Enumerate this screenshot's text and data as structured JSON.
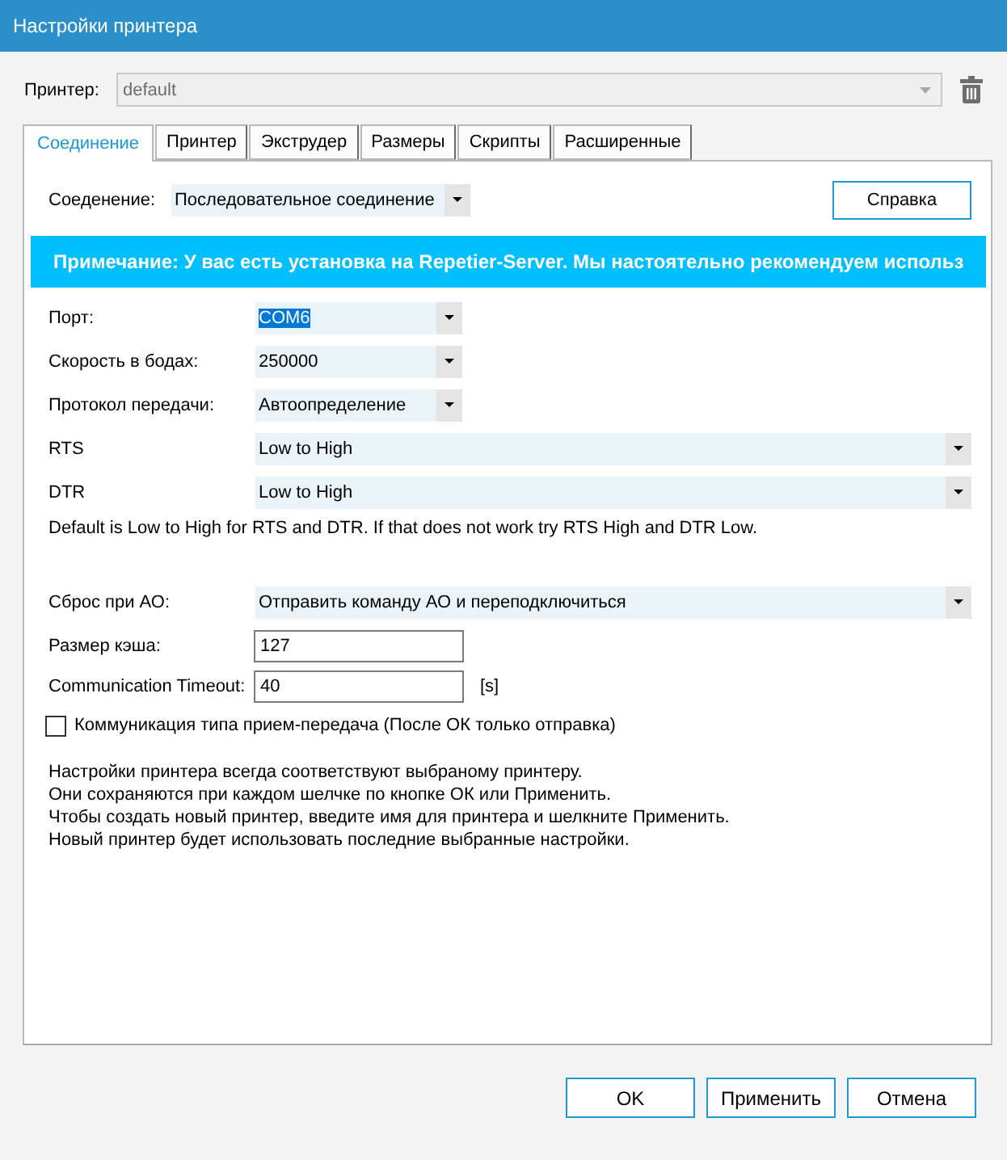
{
  "window": {
    "title": "Настройки принтера"
  },
  "printer": {
    "label": "Принтер:",
    "value": "default",
    "disabled": true
  },
  "tabs": [
    {
      "label": "Соединение",
      "selected": true
    },
    {
      "label": "Принтер",
      "selected": false
    },
    {
      "label": "Экструдер",
      "selected": false
    },
    {
      "label": "Размеры",
      "selected": false
    },
    {
      "label": "Скрипты",
      "selected": false
    },
    {
      "label": "Расширенные",
      "selected": false
    }
  ],
  "connection": {
    "label": "Соеденение:",
    "value": "Последовательное соединение",
    "help_button": "Справка"
  },
  "banner": {
    "text": "Примечание: У вас есть установка на Repetier-Server. Мы настоятельно рекомендуем использ"
  },
  "serial_settings": [
    {
      "label": "Порт:",
      "value": "COM6",
      "text_selected": true
    },
    {
      "label": "Скорость в бодах:",
      "value": "250000",
      "text_selected": false
    },
    {
      "label": "Протокол передачи:",
      "value": "Автоопределение",
      "text_selected": false
    }
  ],
  "signal_settings": [
    {
      "label": "RTS",
      "value": "Low to High"
    },
    {
      "label": "DTR",
      "value": "Low to High"
    }
  ],
  "signal_note": "Default is Low to High for RTS and DTR. If that does not work try RTS High and DTR Low.",
  "reset": {
    "label": "Сброс при АО:",
    "value": "Отправить команду АО и переподключиться"
  },
  "cache": {
    "label": "Размер кэша:",
    "value": "127"
  },
  "timeout": {
    "label": "Communication Timeout:",
    "value": "40",
    "unit": "[s]"
  },
  "ping_pong": {
    "label": "Коммуникация типа прием-передача (После ОК только отправка)",
    "checked": false
  },
  "info": [
    "Настройки принтера всегда соответствуют выбраному принтеру.",
    "Они сохраняются при каждом шелчке по кнопке ОК или Применить.",
    "Чтобы создать новый принтер, введите имя для принтера и шелкните Применить.",
    "Новый принтер будет использовать последние выбранные настройки."
  ],
  "buttons": [
    {
      "label": "OK"
    },
    {
      "label": "Применить"
    },
    {
      "label": "Отмена"
    }
  ]
}
